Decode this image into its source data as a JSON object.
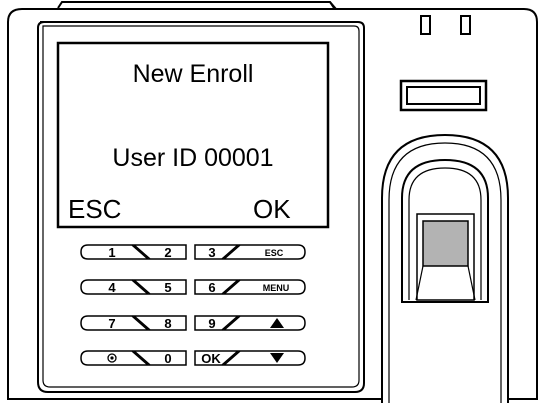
{
  "screen": {
    "title": "New Enroll",
    "user_id_line": "User ID 00001",
    "left_softkey": "ESC",
    "right_softkey": "OK"
  },
  "keypad": {
    "rows": [
      {
        "left": "1",
        "mid": "2",
        "right_num": "3",
        "func": "ESC"
      },
      {
        "left": "4",
        "mid": "5",
        "right_num": "6",
        "func": "MENU"
      },
      {
        "left": "7",
        "mid": "8",
        "right_num": "9",
        "func": "up-arrow-icon"
      },
      {
        "left": "power-icon",
        "mid": "0",
        "right_num": "OK",
        "func": "down-arrow-icon"
      }
    ]
  },
  "colors": {
    "fingerprint_window": "#b3b3b3",
    "outline": "#000000",
    "background": "#ffffff"
  }
}
